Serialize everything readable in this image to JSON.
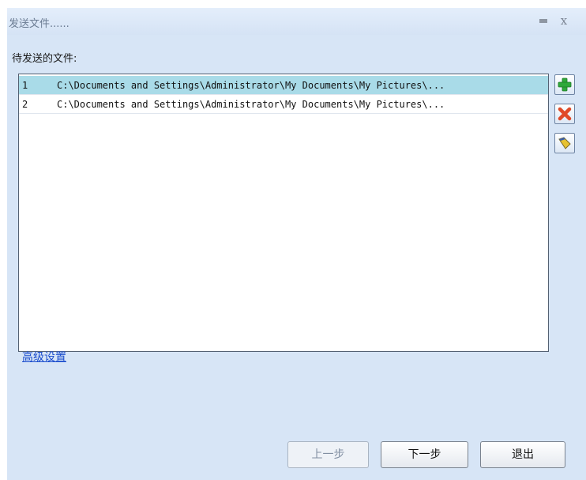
{
  "window": {
    "title": "发送文件......",
    "icons": {
      "minimize": "minimize-icon",
      "close": "close-icon"
    }
  },
  "list": {
    "label": "待发送的文件:",
    "rows": [
      {
        "index": "1",
        "path": "C:\\Documents and Settings\\Administrator\\My Documents\\My Pictures\\...",
        "selected": true
      },
      {
        "index": "2",
        "path": "C:\\Documents and Settings\\Administrator\\My Documents\\My Pictures\\...",
        "selected": false
      }
    ]
  },
  "side_buttons": [
    {
      "icon": "add-icon",
      "color": "#2fa83a"
    },
    {
      "icon": "delete-icon",
      "color": "#e04a28"
    },
    {
      "icon": "clear-icon",
      "color": "#e7c230"
    }
  ],
  "advanced_link": "高级设置",
  "buttons": {
    "prev": "上一步",
    "next": "下一步",
    "exit": "退出"
  },
  "colors": {
    "window_bg": "#d7e5f6",
    "selected_row": "#a9dbe8",
    "link": "#1a4ccd"
  }
}
